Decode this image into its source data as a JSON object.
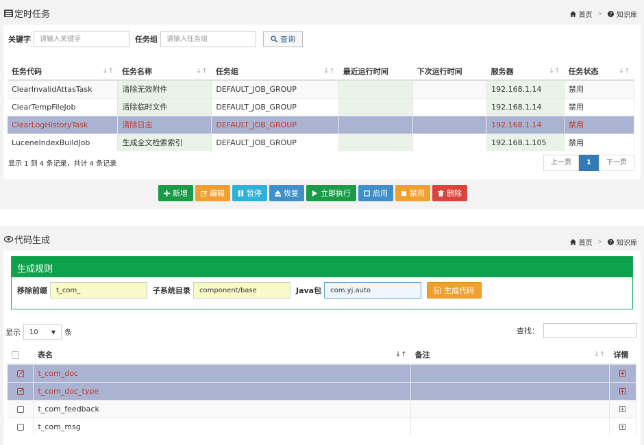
{
  "panel1": {
    "title": "定时任务",
    "crumb_home": "首页",
    "crumb_kb": "知识库",
    "search": {
      "keyword_label": "关键字",
      "keyword_placeholder": "请输入关键字",
      "group_label": "任务组",
      "group_placeholder": "请输入任务组",
      "query_label": "查询"
    },
    "columns": [
      "任务代码",
      "任务名称",
      "任务组",
      "最近运行时间",
      "下次运行时间",
      "服务器",
      "任务状态"
    ],
    "rows": [
      {
        "code": "ClearInvalidAttasTask",
        "name": "清除无效附件",
        "group": "DEFAULT_JOB_GROUP",
        "last": "",
        "next": "",
        "server": "192.168.1.14",
        "status": "禁用"
      },
      {
        "code": "ClearTempFileJob",
        "name": "清除临时文件",
        "group": "DEFAULT_JOB_GROUP",
        "last": "",
        "next": "",
        "server": "192.168.1.14",
        "status": "禁用"
      },
      {
        "code": "ClearLogHistoryTask",
        "name": "清除日志",
        "group": "DEFAULT_JOB_GROUP",
        "last": "",
        "next": "",
        "server": "192.168.1.14",
        "status": "禁用"
      },
      {
        "code": "LuceneIndexBuildJob",
        "name": "生成全文检索索引",
        "group": "DEFAULT_JOB_GROUP",
        "last": "",
        "next": "",
        "server": "192.168.1.105",
        "status": "禁用"
      }
    ],
    "info": "显示 1 到 4 条记录，共计 4 条记录",
    "pager": {
      "prev": "上一页",
      "current": "1",
      "next": "下一页"
    },
    "buttons": [
      {
        "label": "新增",
        "icon": "plus-icon",
        "color": "#1a9b48"
      },
      {
        "label": "编辑",
        "icon": "edit-icon",
        "color": "#f0a030"
      },
      {
        "label": "暂停",
        "icon": "pause-icon",
        "color": "#2eb2d9"
      },
      {
        "label": "恢复",
        "icon": "eject-icon",
        "color": "#3f8fc8"
      },
      {
        "label": "立即执行",
        "icon": "play-icon",
        "color": "#1a9b48"
      },
      {
        "label": "启用",
        "icon": "square-icon",
        "color": "#3f8fc8"
      },
      {
        "label": "禁用",
        "icon": "square-icon",
        "color": "#f0a030"
      },
      {
        "label": "删除",
        "icon": "trash-icon",
        "color": "#d9453c"
      }
    ]
  },
  "panel2": {
    "title": "代码生成",
    "crumb_home": "首页",
    "crumb_kb": "知识库",
    "rules_title": "生成规则",
    "prefix_label": "移除前缀",
    "prefix_value": "t_com_",
    "subsys_label": "子系统目录",
    "subsys_value": "component/base",
    "pkg_label": "Java包",
    "pkg_value": "com.yj.auto",
    "gen_label": "生成代码",
    "show_label": "显示",
    "page_size": "10",
    "unit_label": "条",
    "find_label": "查找：",
    "columns": [
      "表名",
      "备注",
      "详情"
    ],
    "rows": [
      {
        "name": "t_com_doc",
        "remark": "",
        "selected": true
      },
      {
        "name": "t_com_doc_type",
        "remark": "",
        "selected": true
      },
      {
        "name": "t_com_feedback",
        "remark": "",
        "selected": false
      },
      {
        "name": "t_com_msg",
        "remark": "",
        "selected": false
      }
    ]
  },
  "colors": {
    "green_header": "#0da24b",
    "selected_row": "#aab3d1",
    "selected_text": "#c0392b",
    "pager_active": "#337ab7"
  }
}
